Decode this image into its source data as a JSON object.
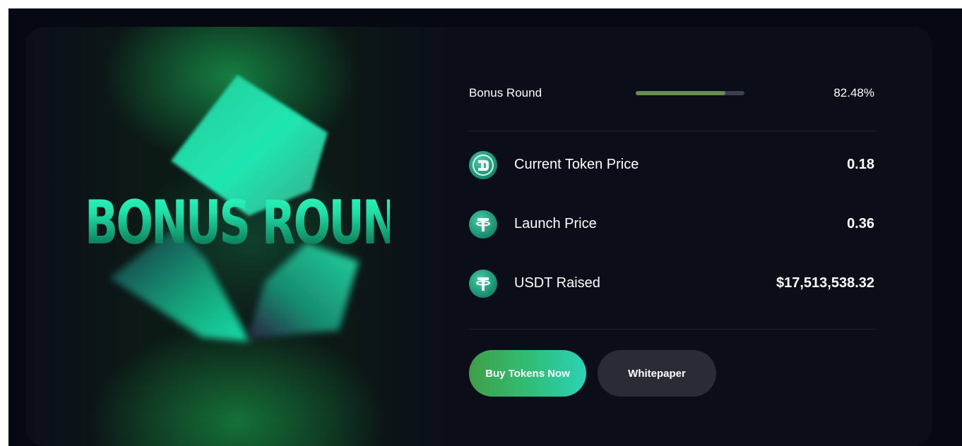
{
  "hero": {
    "title": "BONUS ROUND"
  },
  "round": {
    "label": "Bonus Round",
    "progress_percent": 82.48,
    "progress_text": "82.48%"
  },
  "stats": [
    {
      "icon": "dagger-token-icon",
      "label": "Current Token Price",
      "value": "0.18"
    },
    {
      "icon": "tether-icon",
      "label": "Launch Price",
      "value": "0.36"
    },
    {
      "icon": "tether-icon",
      "label": "USDT Raised",
      "value": "$17,513,538.32"
    }
  ],
  "actions": {
    "buy_label": "Buy Tokens Now",
    "whitepaper_label": "Whitepaper"
  },
  "colors": {
    "accent_green": "#2fbf7a",
    "accent_teal": "#2bd2b8",
    "progress_fill": "#6a8a5a",
    "card_background": "#0b0e18"
  }
}
